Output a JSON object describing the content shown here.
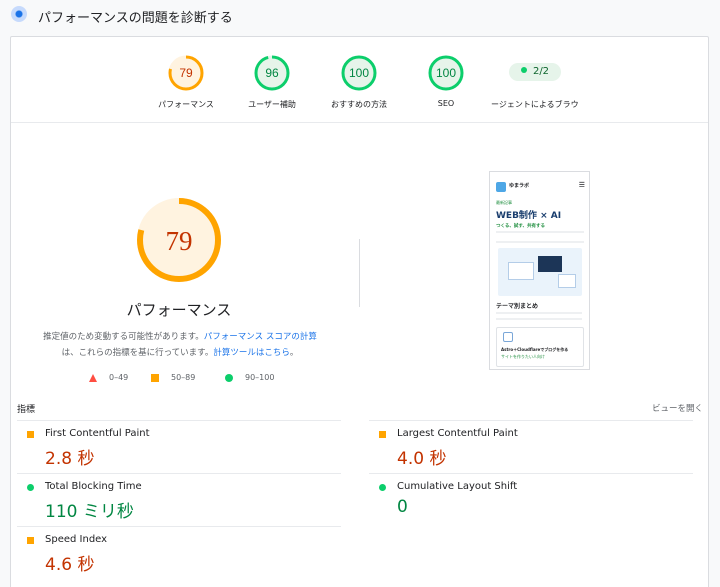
{
  "header": {
    "title": "パフォーマンスの問題を診断する",
    "icon": "diagnose-icon"
  },
  "categories": [
    {
      "score": "79",
      "label": "パフォーマンス",
      "rating": "average",
      "color": "#ffa400"
    },
    {
      "score": "96",
      "label": "ユーザー補助",
      "rating": "pass",
      "color": "#0cce6b"
    },
    {
      "score": "100",
      "label": "おすすめの方法",
      "rating": "pass",
      "color": "#0cce6b"
    },
    {
      "score": "100",
      "label": "SEO",
      "rating": "pass",
      "color": "#0cce6b"
    }
  ],
  "agent": {
    "pill": "2/2",
    "label": "ージェントによるブラウジン"
  },
  "performance": {
    "score": "79",
    "label": "パフォーマンス",
    "desc_1": "推定値のため変動する可能性があります。",
    "desc_link_1": "パフォーマンス スコアの計算",
    "desc_2": "は、これらの指標を基に行っています。",
    "desc_link_2": "計算ツールはこちら",
    "desc_3": "。",
    "legend": [
      {
        "range": "0–49",
        "shape": "triangle",
        "color": "#ff4e42"
      },
      {
        "range": "50–89",
        "shape": "square",
        "color": "#ffa400"
      },
      {
        "range": "90–100",
        "shape": "circle",
        "color": "#0cce6b"
      }
    ]
  },
  "screenshot": {
    "brand": "ゆまラボ",
    "category": "最新記事",
    "heading": "WEB制作 × AI",
    "subheading": "つくる、試す、共有する",
    "section": "テーマ別まとめ",
    "card_title": "Astro＋Cloudflareでブログを作る",
    "card_sub": "サイトを作りたい人向け"
  },
  "metrics": {
    "title": "指標",
    "toggle": "ビューを開く",
    "items": [
      {
        "name": "First Contentful Paint",
        "value": "2.8 秒",
        "rating": "average"
      },
      {
        "name": "Largest Contentful Paint",
        "value": "4.0 秒",
        "rating": "average"
      },
      {
        "name": "Total Blocking Time",
        "value": "110 ミリ秒",
        "rating": "pass"
      },
      {
        "name": "Cumulative Layout Shift",
        "value": "0",
        "rating": "pass"
      },
      {
        "name": "Speed Index",
        "value": "4.6 秒",
        "rating": "average"
      }
    ]
  }
}
